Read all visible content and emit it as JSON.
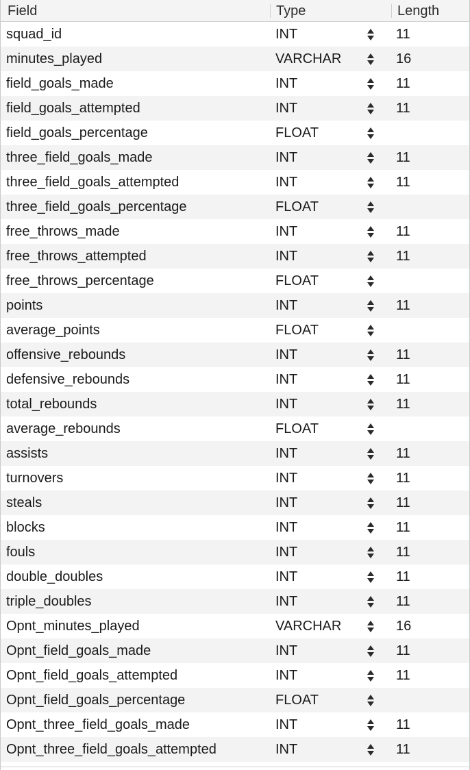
{
  "header": {
    "field": "Field",
    "type": "Type",
    "length": "Length"
  },
  "rows": [
    {
      "field": "squad_id",
      "type": "INT",
      "length": "11"
    },
    {
      "field": "minutes_played",
      "type": "VARCHAR",
      "length": "16"
    },
    {
      "field": "field_goals_made",
      "type": "INT",
      "length": "11"
    },
    {
      "field": "field_goals_attempted",
      "type": "INT",
      "length": "11"
    },
    {
      "field": "field_goals_percentage",
      "type": "FLOAT",
      "length": ""
    },
    {
      "field": "three_field_goals_made",
      "type": "INT",
      "length": "11"
    },
    {
      "field": "three_field_goals_attempted",
      "type": "INT",
      "length": "11"
    },
    {
      "field": "three_field_goals_percentage",
      "type": "FLOAT",
      "length": ""
    },
    {
      "field": "free_throws_made",
      "type": "INT",
      "length": "11"
    },
    {
      "field": "free_throws_attempted",
      "type": "INT",
      "length": "11"
    },
    {
      "field": "free_throws_percentage",
      "type": "FLOAT",
      "length": ""
    },
    {
      "field": "points",
      "type": "INT",
      "length": "11"
    },
    {
      "field": "average_points",
      "type": "FLOAT",
      "length": ""
    },
    {
      "field": "offensive_rebounds",
      "type": "INT",
      "length": "11"
    },
    {
      "field": "defensive_rebounds",
      "type": "INT",
      "length": "11"
    },
    {
      "field": "total_rebounds",
      "type": "INT",
      "length": "11"
    },
    {
      "field": "average_rebounds",
      "type": "FLOAT",
      "length": ""
    },
    {
      "field": "assists",
      "type": "INT",
      "length": "11"
    },
    {
      "field": "turnovers",
      "type": "INT",
      "length": "11"
    },
    {
      "field": "steals",
      "type": "INT",
      "length": "11"
    },
    {
      "field": "blocks",
      "type": "INT",
      "length": "11"
    },
    {
      "field": "fouls",
      "type": "INT",
      "length": "11"
    },
    {
      "field": "double_doubles",
      "type": "INT",
      "length": "11"
    },
    {
      "field": "triple_doubles",
      "type": "INT",
      "length": "11"
    },
    {
      "field": "Opnt_minutes_played",
      "type": "VARCHAR",
      "length": "16"
    },
    {
      "field": "Opnt_field_goals_made",
      "type": "INT",
      "length": "11"
    },
    {
      "field": "Opnt_field_goals_attempted",
      "type": "INT",
      "length": "11"
    },
    {
      "field": "Opnt_field_goals_percentage",
      "type": "FLOAT",
      "length": ""
    },
    {
      "field": "Opnt_three_field_goals_made",
      "type": "INT",
      "length": "11"
    },
    {
      "field": "Opnt_three_field_goals_attempted",
      "type": "INT",
      "length": "11"
    }
  ]
}
